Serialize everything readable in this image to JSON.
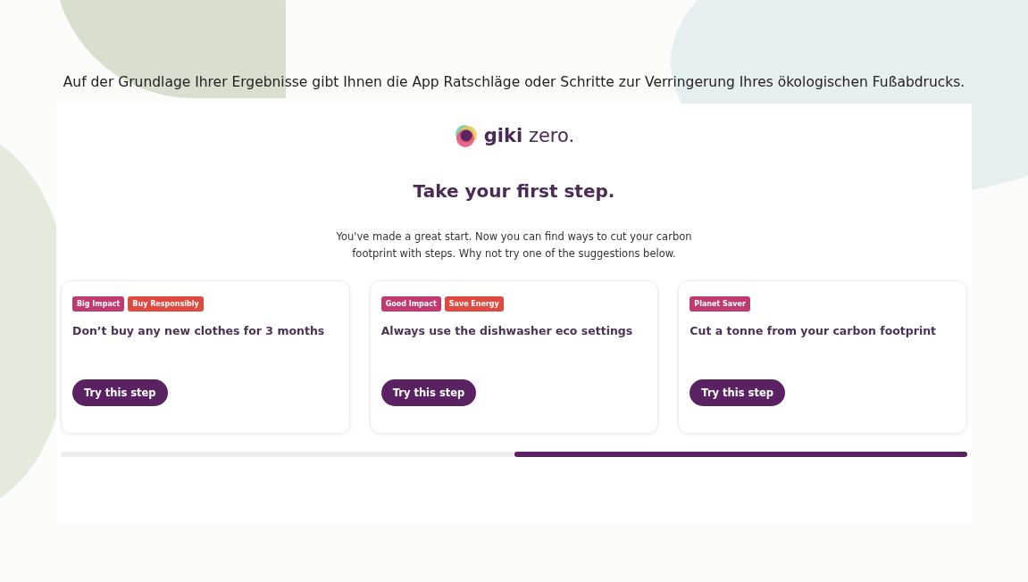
{
  "caption": "Auf der Grundlage Ihrer Ergebnisse gibt Ihnen die App Ratschläge oder Schritte zur Verringerung Ihres ökologischen Fußabdrucks.",
  "app": {
    "logo": "**giki** zero.",
    "heading": "Take your first step.",
    "intro": "You've made a great start. Now you can find ways to cut your carbon footprint with steps. Why not try one of the suggestions below.",
    "cards": [
      {
        "tags": [
          {
            "label": "Big Impact",
            "kind": "impact"
          },
          {
            "label": "Buy Responsibly",
            "kind": "category"
          }
        ],
        "title": "Don’t buy any new clothes for 3 months",
        "button": "Try this step"
      },
      {
        "tags": [
          {
            "label": "Good Impact",
            "kind": "impact"
          },
          {
            "label": "Save Energy",
            "kind": "category"
          }
        ],
        "title": "Always use the dishwasher eco settings",
        "button": "Try this step"
      },
      {
        "tags": [
          {
            "label": "Planet Saver",
            "kind": "impact"
          }
        ],
        "title": "Cut a tonne from your carbon footprint",
        "button": "Try this step"
      }
    ]
  }
}
